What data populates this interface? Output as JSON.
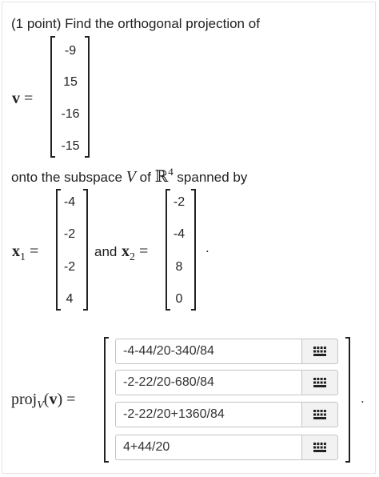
{
  "problem": {
    "intro": "(1 point) Find the orthogonal projection of",
    "onto_prefix": "onto the subspace",
    "subspace_var": "V",
    "of_word": "of",
    "field": "ℝ",
    "dimension": "4",
    "spanned_by": "spanned by",
    "and_word": "and",
    "period": "."
  },
  "v": {
    "label": "v",
    "equals": "=",
    "entries": [
      "-9",
      "15",
      "-16",
      "-15"
    ]
  },
  "x1": {
    "label": "x",
    "subscript": "1",
    "equals": "=",
    "entries": [
      "-4",
      "-2",
      "-2",
      "4"
    ]
  },
  "x2": {
    "label": "x",
    "subscript": "2",
    "equals": "=",
    "entries": [
      "-2",
      "-4",
      "8",
      "0"
    ]
  },
  "answer": {
    "proj_label": "proj",
    "proj_subscript": "V",
    "open_paren": "(",
    "vector_label": "v",
    "close_paren": ")",
    "equals": "=",
    "period": ".",
    "inputs": [
      "-4-44/20-340/84",
      "-2-22/20-680/84",
      "-2-22/20+1360/84",
      "4+44/20"
    ],
    "button_icon": "keyboard-grid-icon"
  }
}
